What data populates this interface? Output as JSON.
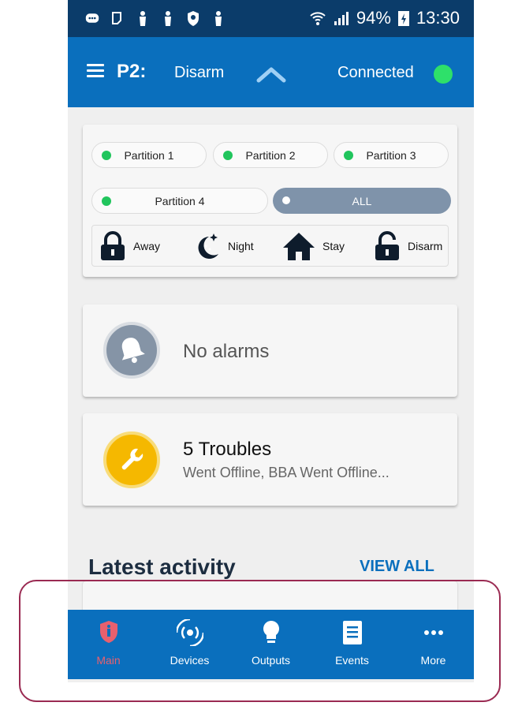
{
  "status_bar": {
    "battery": "94%",
    "time": "13:30"
  },
  "app_bar": {
    "title": "P2:",
    "subtitle": "Disarm",
    "connection": "Connected",
    "connection_color": "#2ee06a"
  },
  "partitions": [
    {
      "label": "Partition 1",
      "status_color": "#21c55d"
    },
    {
      "label": "Partition 2",
      "status_color": "#21c55d"
    },
    {
      "label": "Partition 3",
      "status_color": "#21c55d"
    },
    {
      "label": "Partition 4",
      "status_color": "#21c55d"
    },
    {
      "label": "ALL",
      "status_color": "#ffffff"
    }
  ],
  "modes": [
    {
      "label": "Away",
      "icon": "lock-icon"
    },
    {
      "label": "Night",
      "icon": "moon-stars-icon"
    },
    {
      "label": "Stay",
      "icon": "home-icon"
    },
    {
      "label": "Disarm",
      "icon": "unlock-icon"
    }
  ],
  "alarms": {
    "text": "No alarms",
    "icon": "bell-icon"
  },
  "troubles": {
    "title": "5 Troubles",
    "description": "Went Offline, BBA Went Offline...",
    "icon": "wrench-icon",
    "color": "#f5b800"
  },
  "activity": {
    "heading": "Latest activity",
    "view_all": "VIEW ALL"
  },
  "nav": [
    {
      "label": "Main",
      "icon": "shield-icon",
      "active": true
    },
    {
      "label": "Devices",
      "icon": "sensor-icon",
      "active": false
    },
    {
      "label": "Outputs",
      "icon": "bulb-icon",
      "active": false
    },
    {
      "label": "Events",
      "icon": "list-icon",
      "active": false
    },
    {
      "label": "More",
      "icon": "more-icon",
      "active": false
    }
  ],
  "colors": {
    "primary": "#0a6fbd",
    "status_bar": "#0b3c6a",
    "active_nav": "#e8606e"
  }
}
